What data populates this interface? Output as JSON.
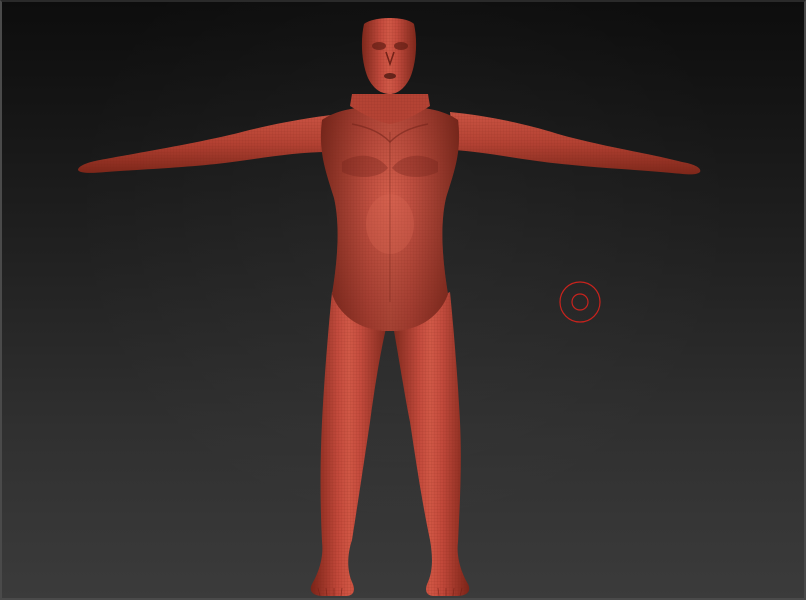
{
  "viewport": {
    "background_top": "#0d0d0d",
    "background_bottom": "#3b3b3b"
  },
  "model": {
    "subject": "t-pose-human-base-mesh",
    "material_color": "#b8402e",
    "material_highlight": "#d45a44",
    "material_shadow": "#6e1e14",
    "wire_color": "#8a2a1c"
  },
  "cursor": {
    "type": "brush-circle",
    "color": "#c8201a"
  }
}
